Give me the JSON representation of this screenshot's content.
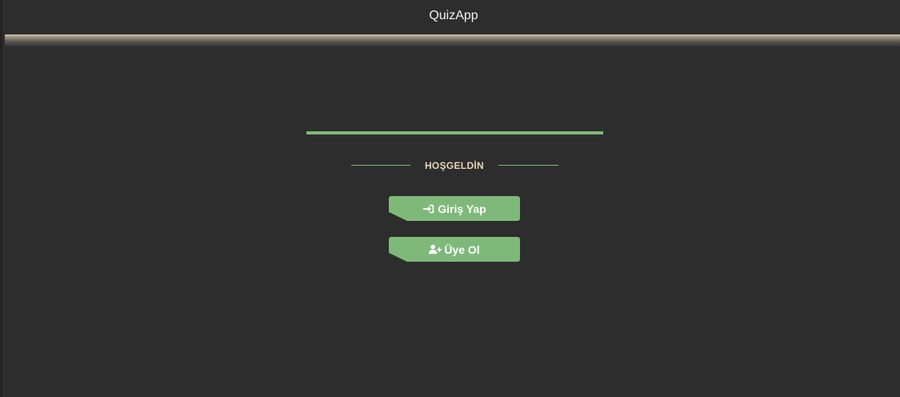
{
  "app": {
    "title": "QuizApp"
  },
  "welcome": {
    "label": "HOŞGELDİN"
  },
  "buttons": {
    "login": {
      "label": "Giriş Yap",
      "icon": "sign-in-icon"
    },
    "register": {
      "label": "Üye Ol",
      "icon": "user-plus-icon"
    }
  },
  "colors": {
    "background": "#2d2d2d",
    "accent": "#7fb97a",
    "welcome_text": "#e6d6b6",
    "title_text": "#f2f2f2"
  }
}
